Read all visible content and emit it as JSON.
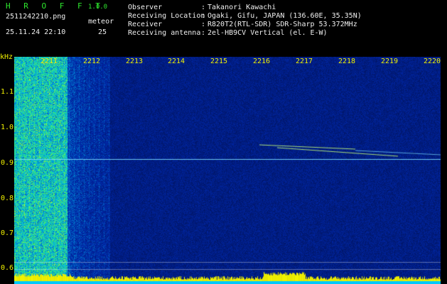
{
  "app": {
    "name": "H R O F F T",
    "version": "1.0.0"
  },
  "file": {
    "name": "2511242210.png",
    "datetime": "25.11.24 22:10"
  },
  "meteor": {
    "label": "meteor",
    "count": "25"
  },
  "info": [
    {
      "label": "Observer",
      "sep": ":",
      "value": "Takanori Kawachi"
    },
    {
      "label": "Receiving Location",
      "sep": ":",
      "value": "Ogaki, Gifu, JAPAN (136.60E, 35.35N)"
    },
    {
      "label": "Receiver",
      "sep": ":",
      "value": "R820T2(RTL-SDR) SDR-Sharp 53.372MHz"
    },
    {
      "label": "Receiving antenna",
      "sep": ":",
      "value": "2el-HB9CV Vertical (el. E-W)"
    }
  ],
  "axis": {
    "unit": "kHz",
    "y_ticks": [
      "1.1",
      "1.0",
      "0.9",
      "0.8",
      "0.7",
      "0.6"
    ],
    "x_ticks": [
      "2211",
      "2212",
      "2213",
      "2214",
      "2215",
      "2216",
      "2217",
      "2218",
      "2219",
      "2220"
    ]
  },
  "colors": {
    "title": "#2ee82e",
    "labels": "#f0f0f0",
    "axis": "#f2f200",
    "signal": "#50e0ff"
  }
}
